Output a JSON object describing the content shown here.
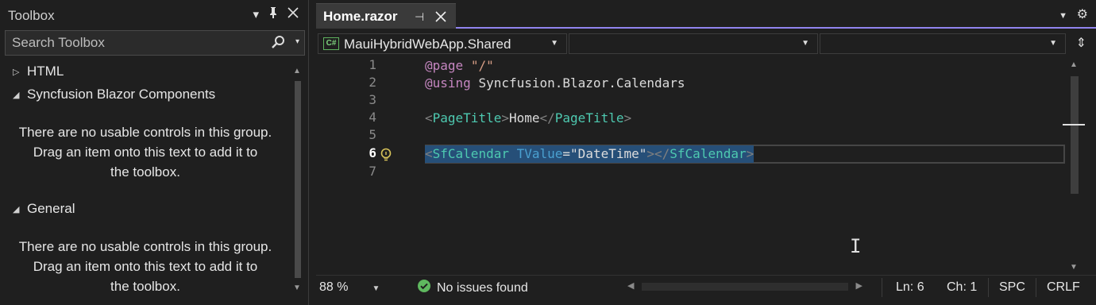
{
  "toolbox": {
    "title": "Toolbox",
    "actions": [
      "chevron-down-icon",
      "pin-icon",
      "close-icon"
    ],
    "search_placeholder": "Search Toolbox",
    "groups": [
      {
        "label": "HTML",
        "expanded": false
      },
      {
        "label": "Syncfusion Blazor Components",
        "expanded": true,
        "message": [
          "There are no usable controls in this group.",
          "Drag an item onto this text to add it to",
          "the toolbox."
        ]
      },
      {
        "label": "General",
        "expanded": true,
        "message": [
          "There are no usable controls in this group.",
          "Drag an item onto this text to add it to",
          "the toolbox."
        ]
      }
    ]
  },
  "editor": {
    "tab": {
      "label": "Home.razor"
    },
    "accent_color": "#9184ee",
    "nav": {
      "project": "MauiHybridWebApp.Shared",
      "project_badge": "C#",
      "type": "",
      "member": ""
    },
    "line_numbers": [
      "1",
      "2",
      "3",
      "4",
      "5",
      "6",
      "7"
    ],
    "current_line": "6",
    "lines": [
      {
        "directive": "@page",
        "value": "\"/\""
      },
      {
        "directive": "@using",
        "value": "Syncfusion.Blazor.Calendars"
      },
      {},
      {
        "open": "<",
        "tag": "PageTitle",
        "close": ">",
        "text": "Home",
        "end_open": "</",
        "end_tag": "PageTitle",
        "end_close": ">"
      },
      {},
      {
        "open": "<",
        "tag": "SfCalendar",
        "attr": "TValue",
        "eq": "=",
        "attr_value": "\"DateTime\"",
        "close": ">",
        "end_open": "</",
        "end_tag": "SfCalendar",
        "end_close": ">"
      },
      {}
    ]
  },
  "status": {
    "zoom": "88 %",
    "issues": "No issues found",
    "ln": "Ln: 6",
    "ch": "Ch: 1",
    "spc": "SPC",
    "crlf": "CRLF"
  }
}
